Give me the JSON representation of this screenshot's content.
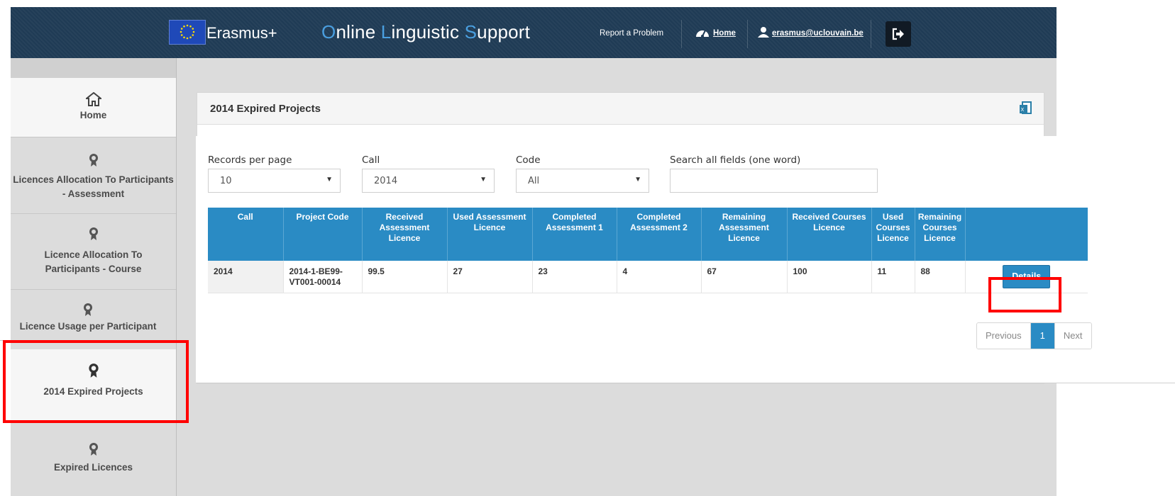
{
  "header": {
    "brand_erasmus": "Erasmus+",
    "brand_ols": [
      {
        "cap": "O",
        "rest": "nline "
      },
      {
        "cap": "L",
        "rest": "inguistic "
      },
      {
        "cap": "S",
        "rest": "upport"
      }
    ],
    "report_problem": "Report a Problem",
    "home_link": "Home",
    "user_email": "erasmus@uclouvain.be"
  },
  "sidebar": {
    "items": [
      {
        "label": "Home",
        "icon": "home-icon",
        "active": true
      },
      {
        "label": "Licences Allocation To Participants - Assessment",
        "icon": "award-icon"
      },
      {
        "label": "Licence Allocation To Participants - Course",
        "icon": "award-icon"
      },
      {
        "label": "Licence Usage per Participant",
        "icon": "award-icon"
      },
      {
        "label": "2014 Expired Projects",
        "icon": "award-icon",
        "active": true
      },
      {
        "label": "Expired Licences",
        "icon": "award-icon"
      }
    ]
  },
  "panel": {
    "title": "2014 Expired Projects"
  },
  "filters": {
    "records_label": "Records per page",
    "records_value": "10",
    "call_label": "Call",
    "call_value": "2014",
    "code_label": "Code",
    "code_value": "All",
    "search_label": "Search all fields (one word)",
    "search_value": ""
  },
  "table": {
    "columns": [
      "Call",
      "Project Code",
      "Received Assessment Licence",
      "Used Assessment Licence",
      "Completed Assessment 1",
      "Completed Assessment 2",
      "Remaining Assessment Licence",
      "Received Courses Licence",
      "Used Courses Licence",
      "Remaining Courses Licence",
      ""
    ],
    "rows": [
      {
        "call": "2014",
        "project_code": "2014-1-BE99-VT001-00014",
        "received_assessment": "99.5",
        "used_assessment": "27",
        "completed_1": "23",
        "completed_2": "4",
        "remaining_assessment": "67",
        "received_courses": "100",
        "used_courses": "11",
        "remaining_courses": "88",
        "action": "Details"
      }
    ]
  },
  "pagination": {
    "previous": "Previous",
    "current": "1",
    "next": "Next"
  },
  "colors": {
    "header_bg": "#1f3b55",
    "accent_blue": "#2a8bc4",
    "highlight_red": "#ff0000"
  }
}
